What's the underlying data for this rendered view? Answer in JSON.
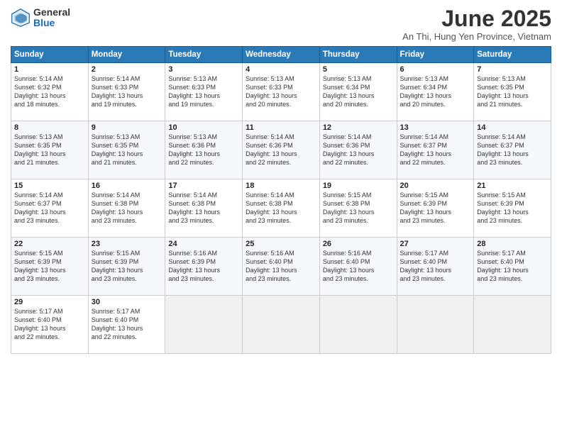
{
  "header": {
    "logo_general": "General",
    "logo_blue": "Blue",
    "title": "June 2025",
    "subtitle": "An Thi, Hung Yen Province, Vietnam"
  },
  "weekdays": [
    "Sunday",
    "Monday",
    "Tuesday",
    "Wednesday",
    "Thursday",
    "Friday",
    "Saturday"
  ],
  "weeks": [
    [
      {
        "day": "1",
        "lines": [
          "Sunrise: 5:14 AM",
          "Sunset: 6:32 PM",
          "Daylight: 13 hours",
          "and 18 minutes."
        ]
      },
      {
        "day": "2",
        "lines": [
          "Sunrise: 5:14 AM",
          "Sunset: 6:33 PM",
          "Daylight: 13 hours",
          "and 19 minutes."
        ]
      },
      {
        "day": "3",
        "lines": [
          "Sunrise: 5:13 AM",
          "Sunset: 6:33 PM",
          "Daylight: 13 hours",
          "and 19 minutes."
        ]
      },
      {
        "day": "4",
        "lines": [
          "Sunrise: 5:13 AM",
          "Sunset: 6:33 PM",
          "Daylight: 13 hours",
          "and 20 minutes."
        ]
      },
      {
        "day": "5",
        "lines": [
          "Sunrise: 5:13 AM",
          "Sunset: 6:34 PM",
          "Daylight: 13 hours",
          "and 20 minutes."
        ]
      },
      {
        "day": "6",
        "lines": [
          "Sunrise: 5:13 AM",
          "Sunset: 6:34 PM",
          "Daylight: 13 hours",
          "and 20 minutes."
        ]
      },
      {
        "day": "7",
        "lines": [
          "Sunrise: 5:13 AM",
          "Sunset: 6:35 PM",
          "Daylight: 13 hours",
          "and 21 minutes."
        ]
      }
    ],
    [
      {
        "day": "8",
        "lines": [
          "Sunrise: 5:13 AM",
          "Sunset: 6:35 PM",
          "Daylight: 13 hours",
          "and 21 minutes."
        ]
      },
      {
        "day": "9",
        "lines": [
          "Sunrise: 5:13 AM",
          "Sunset: 6:35 PM",
          "Daylight: 13 hours",
          "and 21 minutes."
        ]
      },
      {
        "day": "10",
        "lines": [
          "Sunrise: 5:13 AM",
          "Sunset: 6:36 PM",
          "Daylight: 13 hours",
          "and 22 minutes."
        ]
      },
      {
        "day": "11",
        "lines": [
          "Sunrise: 5:14 AM",
          "Sunset: 6:36 PM",
          "Daylight: 13 hours",
          "and 22 minutes."
        ]
      },
      {
        "day": "12",
        "lines": [
          "Sunrise: 5:14 AM",
          "Sunset: 6:36 PM",
          "Daylight: 13 hours",
          "and 22 minutes."
        ]
      },
      {
        "day": "13",
        "lines": [
          "Sunrise: 5:14 AM",
          "Sunset: 6:37 PM",
          "Daylight: 13 hours",
          "and 22 minutes."
        ]
      },
      {
        "day": "14",
        "lines": [
          "Sunrise: 5:14 AM",
          "Sunset: 6:37 PM",
          "Daylight: 13 hours",
          "and 23 minutes."
        ]
      }
    ],
    [
      {
        "day": "15",
        "lines": [
          "Sunrise: 5:14 AM",
          "Sunset: 6:37 PM",
          "Daylight: 13 hours",
          "and 23 minutes."
        ]
      },
      {
        "day": "16",
        "lines": [
          "Sunrise: 5:14 AM",
          "Sunset: 6:38 PM",
          "Daylight: 13 hours",
          "and 23 minutes."
        ]
      },
      {
        "day": "17",
        "lines": [
          "Sunrise: 5:14 AM",
          "Sunset: 6:38 PM",
          "Daylight: 13 hours",
          "and 23 minutes."
        ]
      },
      {
        "day": "18",
        "lines": [
          "Sunrise: 5:14 AM",
          "Sunset: 6:38 PM",
          "Daylight: 13 hours",
          "and 23 minutes."
        ]
      },
      {
        "day": "19",
        "lines": [
          "Sunrise: 5:15 AM",
          "Sunset: 6:38 PM",
          "Daylight: 13 hours",
          "and 23 minutes."
        ]
      },
      {
        "day": "20",
        "lines": [
          "Sunrise: 5:15 AM",
          "Sunset: 6:39 PM",
          "Daylight: 13 hours",
          "and 23 minutes."
        ]
      },
      {
        "day": "21",
        "lines": [
          "Sunrise: 5:15 AM",
          "Sunset: 6:39 PM",
          "Daylight: 13 hours",
          "and 23 minutes."
        ]
      }
    ],
    [
      {
        "day": "22",
        "lines": [
          "Sunrise: 5:15 AM",
          "Sunset: 6:39 PM",
          "Daylight: 13 hours",
          "and 23 minutes."
        ]
      },
      {
        "day": "23",
        "lines": [
          "Sunrise: 5:15 AM",
          "Sunset: 6:39 PM",
          "Daylight: 13 hours",
          "and 23 minutes."
        ]
      },
      {
        "day": "24",
        "lines": [
          "Sunrise: 5:16 AM",
          "Sunset: 6:39 PM",
          "Daylight: 13 hours",
          "and 23 minutes."
        ]
      },
      {
        "day": "25",
        "lines": [
          "Sunrise: 5:16 AM",
          "Sunset: 6:40 PM",
          "Daylight: 13 hours",
          "and 23 minutes."
        ]
      },
      {
        "day": "26",
        "lines": [
          "Sunrise: 5:16 AM",
          "Sunset: 6:40 PM",
          "Daylight: 13 hours",
          "and 23 minutes."
        ]
      },
      {
        "day": "27",
        "lines": [
          "Sunrise: 5:17 AM",
          "Sunset: 6:40 PM",
          "Daylight: 13 hours",
          "and 23 minutes."
        ]
      },
      {
        "day": "28",
        "lines": [
          "Sunrise: 5:17 AM",
          "Sunset: 6:40 PM",
          "Daylight: 13 hours",
          "and 23 minutes."
        ]
      }
    ],
    [
      {
        "day": "29",
        "lines": [
          "Sunrise: 5:17 AM",
          "Sunset: 6:40 PM",
          "Daylight: 13 hours",
          "and 22 minutes."
        ]
      },
      {
        "day": "30",
        "lines": [
          "Sunrise: 5:17 AM",
          "Sunset: 6:40 PM",
          "Daylight: 13 hours",
          "and 22 minutes."
        ]
      },
      {
        "day": "",
        "lines": []
      },
      {
        "day": "",
        "lines": []
      },
      {
        "day": "",
        "lines": []
      },
      {
        "day": "",
        "lines": []
      },
      {
        "day": "",
        "lines": []
      }
    ]
  ]
}
